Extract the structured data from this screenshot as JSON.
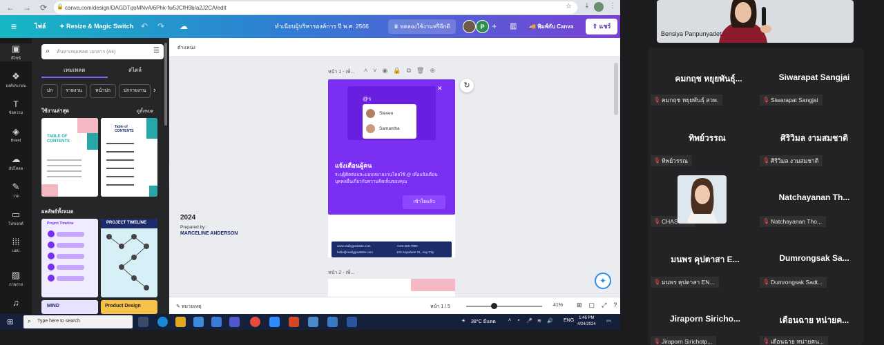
{
  "browser": {
    "url": "canva.com/design/DAGDTqoMNvA/6Phk-fw5JCfH9b/a2J2CA/edit",
    "nav_icons": [
      "back-icon",
      "forward-icon",
      "reload-icon"
    ]
  },
  "canva_topbar": {
    "file_label": "ไฟล์",
    "resize_label": "Resize & Magic Switch",
    "design_title": "ทำเนียบผู้บริหารองค์การ ปี พ.ศ. 2566",
    "trial_label": "ทดลองใช้งานฟรีอีกดี",
    "avatar_letter": "P",
    "print_label": "พิมพ์กับ Canva",
    "share_label": "แชร์"
  },
  "rail": {
    "items": [
      {
        "icon": "layout-icon",
        "label": "ดีไซน์"
      },
      {
        "icon": "elements-icon",
        "label": "องค์ประกอบ"
      },
      {
        "icon": "text-icon",
        "label": "ข้อความ"
      },
      {
        "icon": "brand-icon",
        "label": "Brand"
      },
      {
        "icon": "upload-icon",
        "label": "อัปโหลด"
      },
      {
        "icon": "draw-icon",
        "label": "วาด"
      },
      {
        "icon": "projects-icon",
        "label": "โปรเจกต์"
      },
      {
        "icon": "apps-icon",
        "label": "แอป"
      },
      {
        "icon": "photos-icon",
        "label": "ภาพถ่าย"
      },
      {
        "icon": "audio-icon",
        "label": ""
      }
    ]
  },
  "panel": {
    "search_placeholder": "ค้นหาเทมเพลต เอกสาร (A4)",
    "tabs": [
      "เทมเพลต",
      "สไตล์"
    ],
    "chips": [
      "ปก",
      "รายงาน",
      "หน้าปก",
      "ปกรายงาน"
    ],
    "section_recent": "ใช้งานล่าสุด",
    "see_all": "ดูทั้งหมด",
    "section_all": "ผลลัพธ์ทั้งหมด",
    "thumb1_title": "TABLE OF CONTENTS",
    "thumb2_title": "Table of CONTENTS",
    "thumb3_title": "Project Timeline",
    "thumb4_title": "PROJECT TIMELINE",
    "thumb5_title": "MIND",
    "thumb6_title": "Product Design"
  },
  "canvas": {
    "header_label": "ตำแหน่ง",
    "page1_label": "หน้า 1 - เพิ่...",
    "page2_label": "หน้า 2 - เพิ่...",
    "page1_year": "2024",
    "page1_prepared": "Prepared by :",
    "page1_name": "MARCELINE ANDERSON",
    "band_web": "www.reallygreatsite.com",
    "band_email": "hello@reallygreatsite.com",
    "band_phone": "+123-456-7890",
    "band_addr": "123 Anywhere St., Any City"
  },
  "popup": {
    "mention": "@ร",
    "people": [
      "Steven",
      "Samantha"
    ],
    "title": "แจ้งเตือนผู้คน",
    "description": "ระบุผู้ติดต่อและมอบหมายงานโดยใช้ @ เพื่อแจ้งเตือนบุคคลอื่นเกี่ยวกับความคิดเห็นของคุณ",
    "button": "เข้าใจแล้ว"
  },
  "footer": {
    "notes_label": "หมายเหตุ",
    "page_indicator": "หน้า 1 / 5",
    "zoom": "41%"
  },
  "taskbar": {
    "search_placeholder": "Type here to search",
    "weather": "38°C มีแดด",
    "lang": "ENG",
    "time": "1:46 PM",
    "date": "4/24/2024"
  },
  "meeting": {
    "presenter_name": "Bensiya Panpunyadet",
    "participants": [
      {
        "name": "คมกฤช หยุยพันธุ์...",
        "tag": "คมกฤช หยุยพันธุ์ สวพ."
      },
      {
        "name": "Siwarapat Sangjai",
        "tag": "Siwarapat Sangjai"
      },
      {
        "name": "ทิพย์วรรณ",
        "tag": "ทิพย์วรรณ"
      },
      {
        "name": "ศิริวิมล งามสมชาติ",
        "tag": "ศิริวิมล งามสมชาติ"
      },
      {
        "name": "",
        "tag": "CHASUDA"
      },
      {
        "name": "Natchayanan Th...",
        "tag": "Natchayanan Tho..."
      },
      {
        "name": "มนพร คุปตาสา E...",
        "tag": "มนพร คุปตาสา EN..."
      },
      {
        "name": "Dumrongsak Sa...",
        "tag": "Dumrongsak Sadt..."
      },
      {
        "name": "Jiraporn Siricho...",
        "tag": "Jiraporn Sirichotp..."
      },
      {
        "name": "เดือนฉาย หน่ายค...",
        "tag": "เดือนฉาย หน่ายคน..."
      }
    ]
  }
}
